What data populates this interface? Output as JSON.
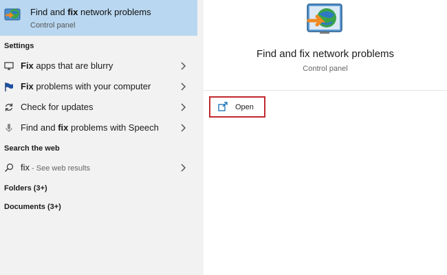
{
  "best_match": {
    "title_pre": "Find and ",
    "title_hl": "fix",
    "title_post": " network problems",
    "subtitle": "Control panel"
  },
  "sections": {
    "settings": "Settings",
    "web": "Search the web",
    "folders": "Folders (3+)",
    "documents": "Documents (3+)"
  },
  "settings_items": [
    {
      "pre": "",
      "hl": "Fix",
      "post": " apps that are blurry"
    },
    {
      "pre": "",
      "hl": "Fix",
      "post": " problems with your computer"
    },
    {
      "pre": "Check for updates",
      "hl": "",
      "post": ""
    },
    {
      "pre": "Find and ",
      "hl": "fix",
      "post": " problems with Speech"
    }
  ],
  "web_item": {
    "query": "fix",
    "suffix": " - See web results"
  },
  "detail": {
    "title": "Find and fix network problems",
    "subtitle": "Control panel",
    "open_label": "Open"
  },
  "colors": {
    "selected_bg": "#b9d7f0",
    "open_border": "#c0282d",
    "accent": "#0063b1"
  }
}
